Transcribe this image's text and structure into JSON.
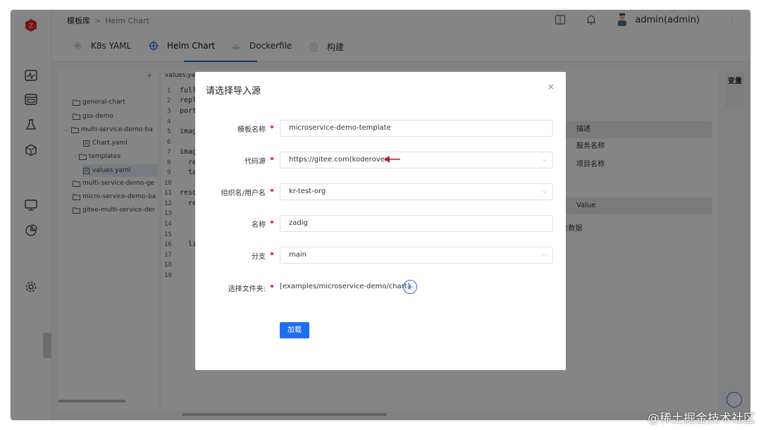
{
  "header": {
    "breadcrumb": [
      "模板库",
      "Helm Chart"
    ],
    "breadcrumb_sep": ">",
    "user": "admin(admin)"
  },
  "tabs": [
    {
      "label": "K8s YAML",
      "icon": "k8s-icon"
    },
    {
      "label": "Helm Chart",
      "icon": "helm-icon",
      "active": true
    },
    {
      "label": "Dockerfile",
      "icon": "docker-icon"
    },
    {
      "label": "构建",
      "icon": "build-icon"
    }
  ],
  "tree": {
    "items": [
      {
        "label": "general-chart",
        "type": "folder",
        "indent": 0
      },
      {
        "label": "gss-demo",
        "type": "folder",
        "indent": 0
      },
      {
        "label": "multi-service-demo-ba",
        "type": "folder",
        "indent": 0,
        "expanded": true
      },
      {
        "label": "Chart.yaml",
        "type": "file",
        "indent": 1
      },
      {
        "label": "templates",
        "type": "folder",
        "indent": 1
      },
      {
        "label": "values.yaml",
        "type": "file",
        "indent": 1,
        "selected": true
      },
      {
        "label": "multi-service-demo-ge",
        "type": "folder",
        "indent": 0
      },
      {
        "label": "micro-service-demo-ba",
        "type": "folder",
        "indent": 0
      },
      {
        "label": "gitee-multi-service-der",
        "type": "folder",
        "indent": 0
      }
    ]
  },
  "editor": {
    "filename": "values.yam",
    "line_numbers": [
      "1",
      "2",
      "3",
      "4",
      "5",
      "6",
      "7",
      "8",
      "9",
      "10",
      "11",
      "12",
      "13",
      "14",
      "15",
      "16",
      "17",
      "18",
      "19"
    ],
    "code": [
      {
        "line": 1,
        "text": "full"
      },
      {
        "line": 2,
        "text": "repl"
      },
      {
        "line": 3,
        "text": "port"
      },
      {
        "line": 5,
        "text": "imag"
      },
      {
        "line": 7,
        "text": "imag"
      },
      {
        "line": 8,
        "text": "  re"
      },
      {
        "line": 9,
        "text": "  ta"
      },
      {
        "line": 11,
        "text": "reso"
      },
      {
        "line": 12,
        "text": "  re"
      },
      {
        "line": 16,
        "text": "  li"
      }
    ]
  },
  "right_panel": {
    "side_tab": "变量",
    "rows": [
      "描述",
      "服务名称",
      "项目名称"
    ],
    "value_header": "Value",
    "empty_text": "E数据"
  },
  "modal": {
    "title": "请选择导入源",
    "close": "×",
    "fields": [
      {
        "label": "模板名称",
        "value": "microservice-demo-template",
        "type": "input"
      },
      {
        "label": "代码源",
        "value": "https://gitee.com(koderover)",
        "type": "select"
      },
      {
        "label": "组织名/用户名",
        "value": "kr-test-org",
        "type": "select"
      },
      {
        "label": "名称",
        "value": "zadig",
        "type": "input"
      },
      {
        "label": "分支",
        "value": "main",
        "type": "select"
      },
      {
        "label": "选择文件夹:",
        "value": "[examples/microservice-demo/chart]",
        "type": "path"
      }
    ],
    "add_symbol": "+",
    "submit": "加载"
  },
  "watermark": "@稀土掘金技术社区",
  "colors": {
    "accent": "#1e6ef0",
    "required": "#e0262f",
    "arrow": "#c8102e"
  }
}
